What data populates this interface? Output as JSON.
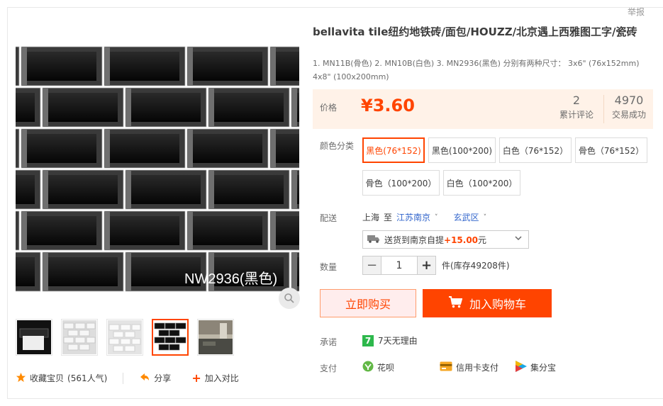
{
  "report_label": "举报",
  "product": {
    "title": "bellavita tile纽约地铁砖/面包/HOUZZ/北京遇上西雅图工字/瓷砖",
    "subtitle": "1. MN11B(骨色) 2. MN10B(白色) 3. MN2936(黑色) 分别有两种尺寸： 3x6\" (76x152mm) 4x8\" (100x200mm)"
  },
  "gallery": {
    "main_caption": "NW2936(黑色)",
    "thumbnails": [
      "black-tiles-sample",
      "white-bevel-tiles",
      "white-bevel-tiles-2",
      "black-bevel-tiles",
      "kitchen-scene"
    ],
    "active_thumbnail": 3
  },
  "price": {
    "label": "价格",
    "value": "¥3.60",
    "reviews_count": "2",
    "reviews_label": "累计评论",
    "sales_count": "4970",
    "sales_label": "交易成功"
  },
  "color": {
    "label": "颜色分类",
    "options": [
      "黑色(76*152)",
      "黑色(100*200)",
      "白色（76*152）",
      "骨色（76*152）",
      "骨色（100*200）",
      "白色（100*200）"
    ],
    "selected": "黑色(76*152)"
  },
  "delivery": {
    "label": "配送",
    "from": "上海",
    "to_word": "至",
    "province": "江苏南京",
    "district": "玄武区",
    "method_prefix": "送货到南京自提",
    "method_fee": "+15.00",
    "method_suffix": "元"
  },
  "quantity": {
    "label": "数量",
    "value": "1",
    "minus": "−",
    "plus": "+",
    "stock": "件(库存49208件)"
  },
  "buttons": {
    "buy_now": "立即购买",
    "add_cart": "加入购物车"
  },
  "promise": {
    "label": "承诺",
    "badge": "7",
    "text": "7天无理由"
  },
  "payment": {
    "label": "支付",
    "methods": [
      "花呗",
      "信用卡支付",
      "集分宝"
    ]
  },
  "bottom_actions": {
    "favorite": "收藏宝贝",
    "favorite_count": "(561人气)",
    "share": "分享",
    "compare": "加入对比"
  },
  "colors": {
    "accent": "#ff4400",
    "price_bg": "#fff2e8",
    "link": "#3366cc"
  }
}
